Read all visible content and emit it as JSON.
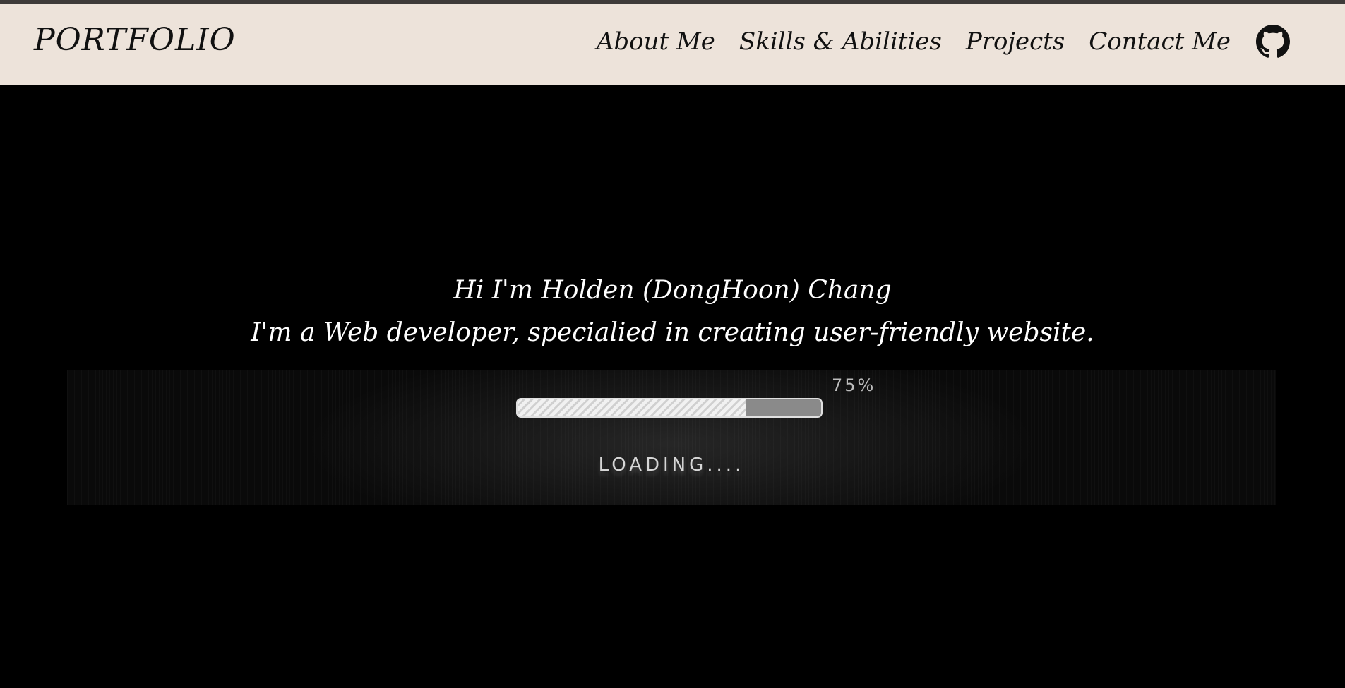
{
  "brand": "PORTFOLIO",
  "nav": {
    "items": [
      "About Me",
      "Skills & Abilities",
      "Projects",
      "Contact Me"
    ],
    "github_icon": "github-icon"
  },
  "hero": {
    "greeting": "Hi I'm Holden (DongHoon) Chang",
    "tagline": "I'm a Web developer, specialied in creating user-friendly website."
  },
  "loader": {
    "percent_label": "75%",
    "progress_fraction": 0.75,
    "status_text": "LOADING...."
  },
  "colors": {
    "navbar_bg": "#ede3da",
    "top_strip": "#3e3b39",
    "page_bg": "#000000",
    "text_light": "#ffffff",
    "text_dark": "#111111"
  }
}
